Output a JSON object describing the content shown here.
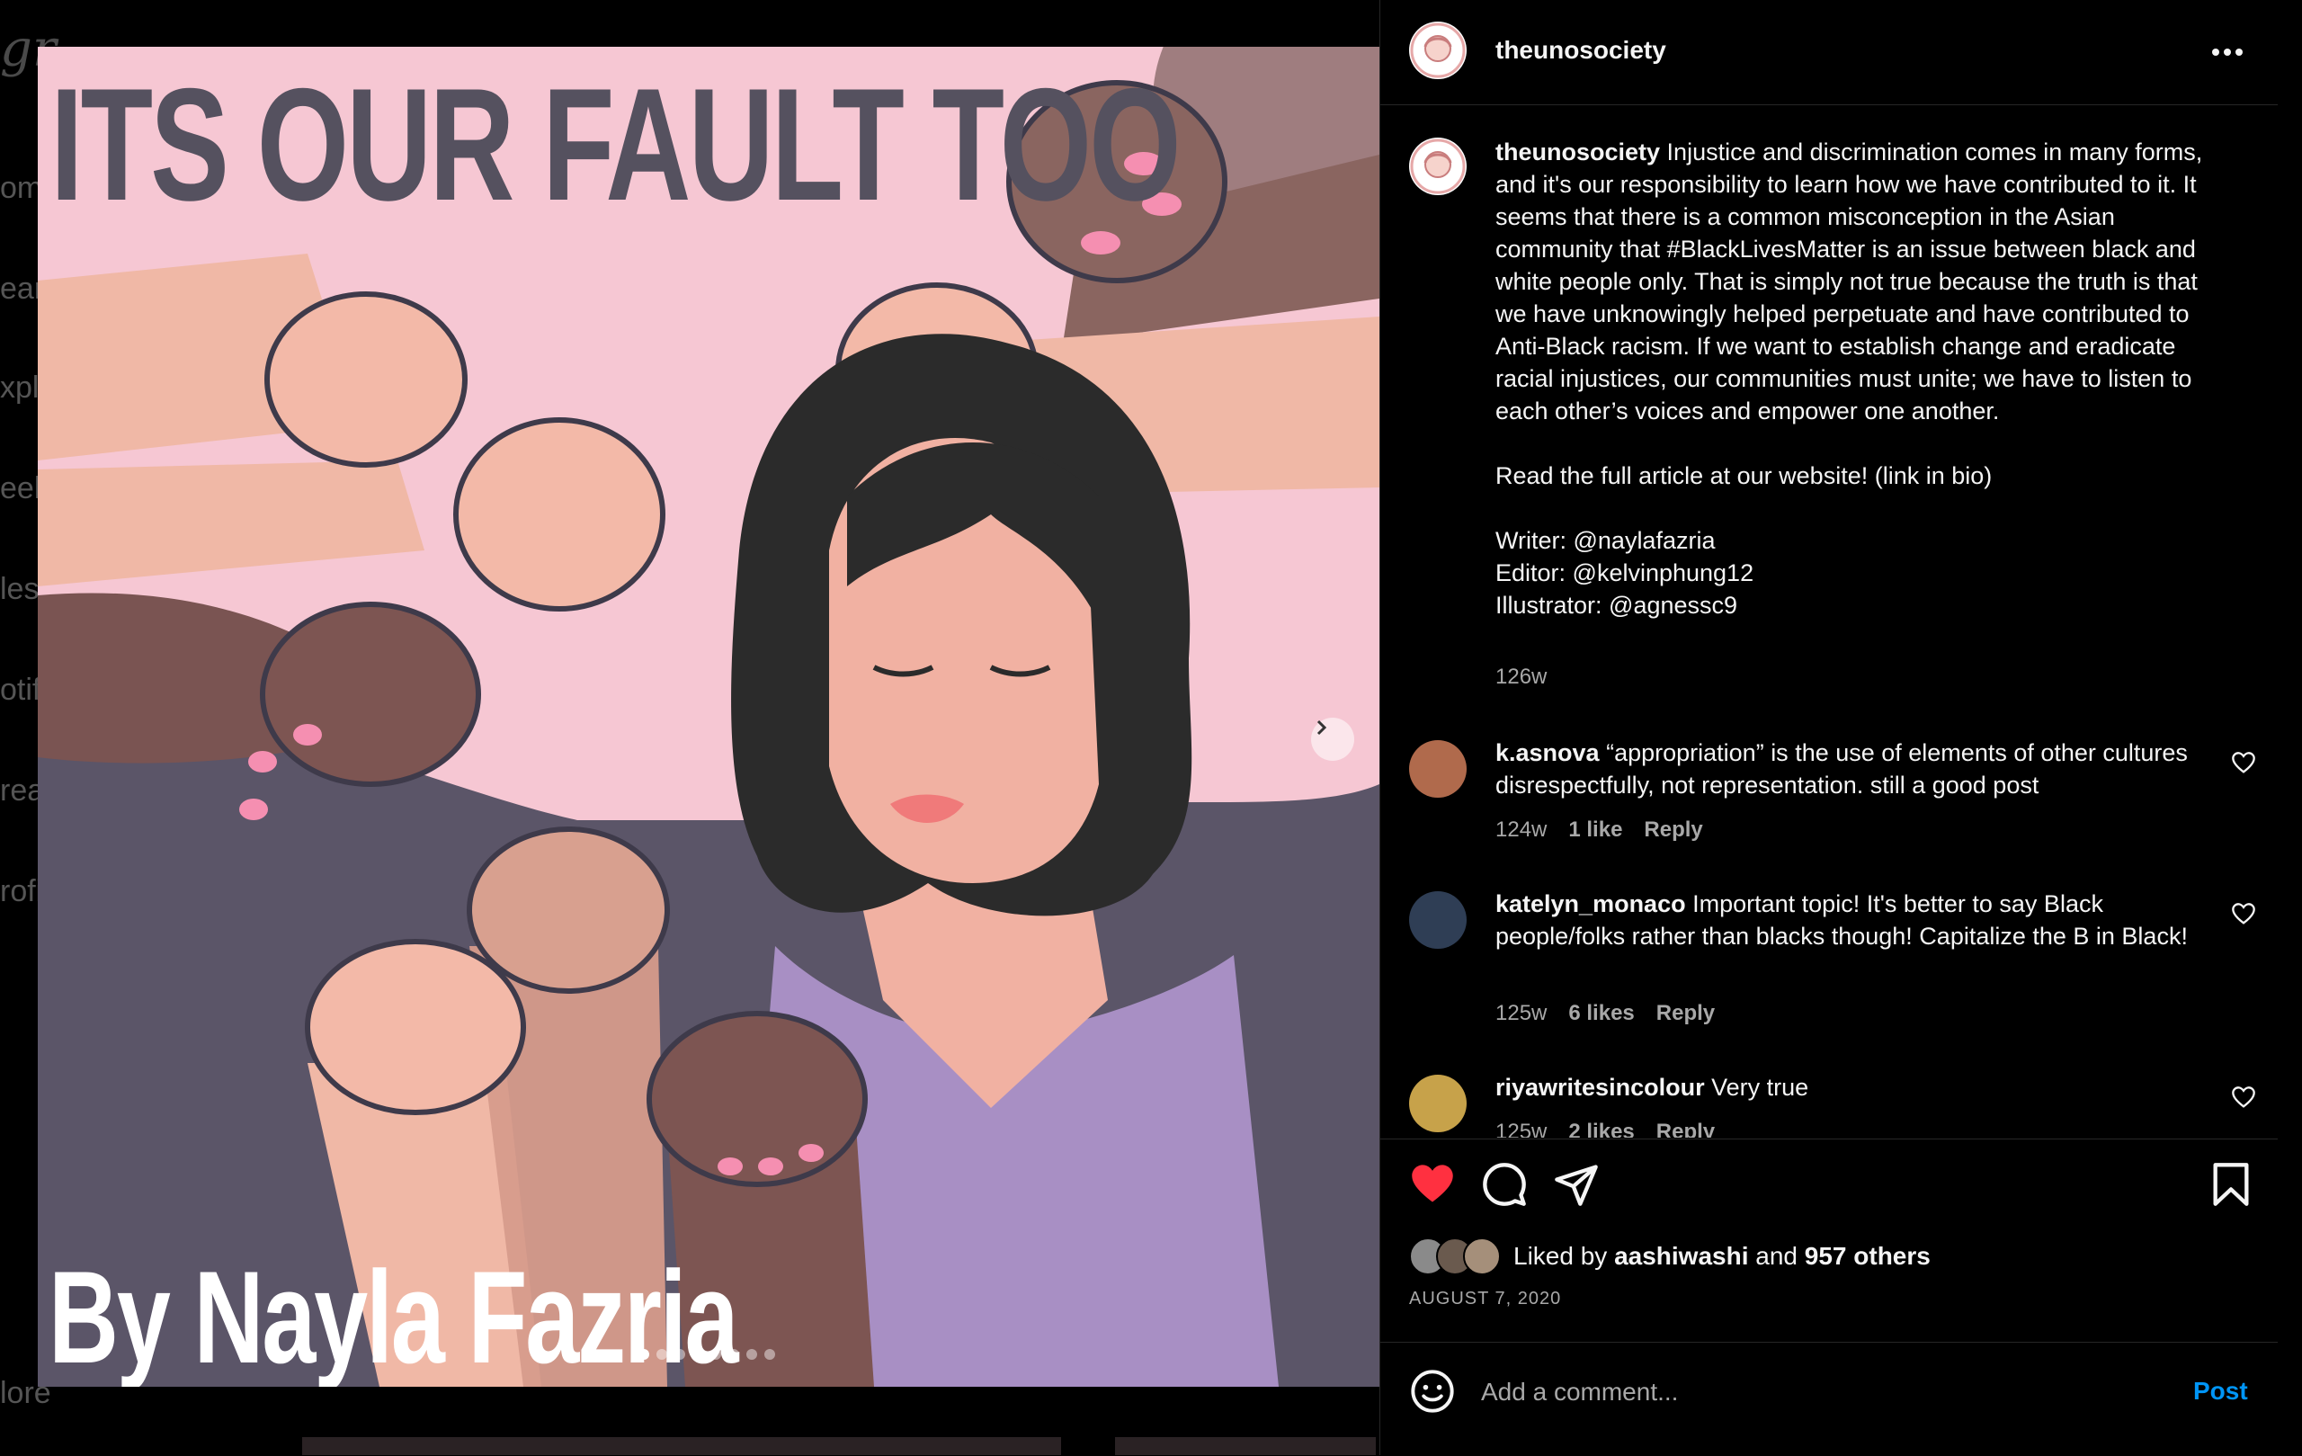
{
  "background": {
    "logo_fragment": "gr",
    "nav_fragments": [
      "om",
      "ear",
      "xplo",
      "eels",
      "less",
      "otif",
      "rea",
      "rofi",
      "lore"
    ]
  },
  "post": {
    "image": {
      "title": "ITS OUR FAULT TOO",
      "byline": "By Nayla Fazria",
      "carousel_total": 8,
      "carousel_current": 1
    },
    "author": "theunosociety",
    "caption_body": "Injustice and discrimination comes in many forms, and it's our responsibility to learn how we have contributed to it. It seems that there is a common misconception in the Asian community that #BlackLivesMatter is an issue between black and white people only. That is simply not true because the truth is that we have unknowingly helped perpetuate and have contributed to Anti-Black racism. If we want to establish change and eradicate racial injustices, our communities must unite; we have to listen to each other’s voices and empower one another.\n\nRead the full article at our website! (link in bio)\n\nWriter: @naylafazria\nEditor: @kelvinphung12\nIllustrator: @agnessc9",
    "caption_time": "126w",
    "comments": [
      {
        "user": "k.asnova",
        "text": "“appropriation” is the use of elements of other cultures disrespectfully, not representation. still a good post",
        "time": "124w",
        "likes": "1 like",
        "reply": "Reply"
      },
      {
        "user": "katelyn_monaco",
        "text": "Important topic! It's better to say Black people/folks rather than blacks though! Capitalize the B in Black!",
        "time": "125w",
        "likes": "6 likes",
        "reply": "Reply"
      },
      {
        "user": "riyawritesincolour",
        "text": "Very true",
        "time": "125w",
        "likes": "2 likes",
        "reply": "Reply"
      }
    ],
    "liked_by_prefix": "Liked by",
    "liked_by_user": "aashiwashi",
    "liked_by_and": "and",
    "liked_by_others": "957 others",
    "date": "AUGUST 7, 2020",
    "add_comment_placeholder": "Add a comment...",
    "post_label": "Post"
  },
  "icons": {
    "more": "more-options-icon",
    "like": "heart-filled-icon",
    "comment": "comment-icon",
    "share": "share-icon",
    "save": "bookmark-icon",
    "emoji": "emoji-icon",
    "next": "chevron-right-icon"
  },
  "colors": {
    "like_red": "#ff3040",
    "link_blue": "#0095f6",
    "image_pink": "#f6c7d3"
  }
}
